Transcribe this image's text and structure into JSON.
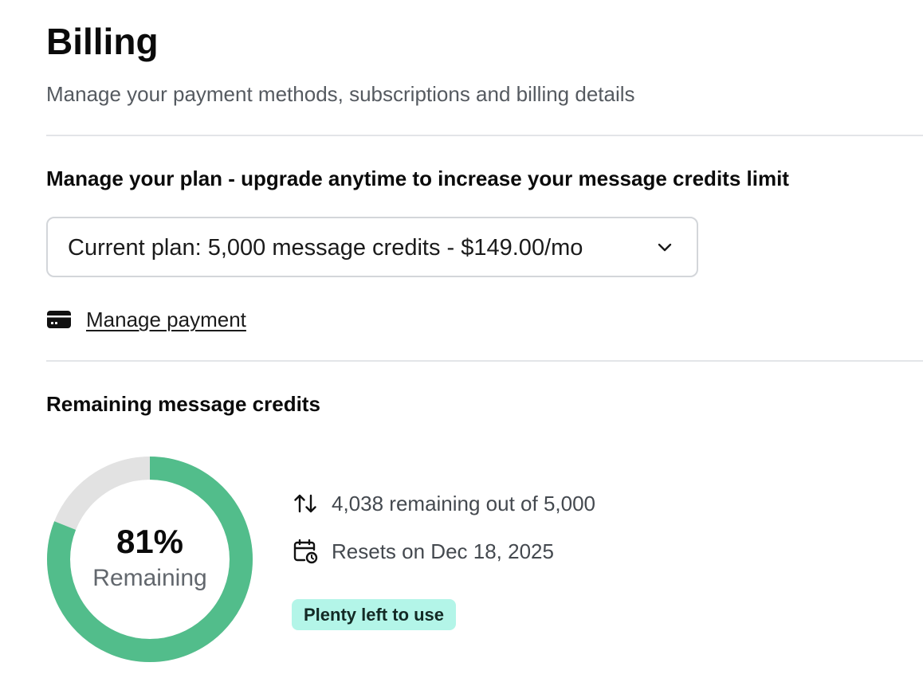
{
  "header": {
    "title": "Billing",
    "subtitle": "Manage your payment methods, subscriptions and billing details"
  },
  "plan": {
    "heading": "Manage your plan - upgrade anytime to increase your message credits limit",
    "select_value": "Current plan: 5,000 message credits - $149.00/mo",
    "select_icon": "chevron-down-icon",
    "manage_payment_label": "Manage payment",
    "manage_payment_icon": "credit-card-icon"
  },
  "credits": {
    "heading": "Remaining message credits",
    "percent_label": "81%",
    "remaining_fraction": 0.81,
    "caption": "Remaining",
    "remaining_text": "4,038 remaining out of 5,000",
    "remaining_icon": "arrows-up-down-icon",
    "reset_text": "Resets on Dec 18, 2025",
    "reset_icon": "calendar-clock-icon",
    "status_badge": "Plenty left to use"
  },
  "colors": {
    "accent_green": "#52bd8b",
    "track_gray": "#e2e2e2",
    "badge_background": "#b3f5e8",
    "text_primary": "#0b0b0b",
    "text_secondary": "#555a60",
    "border": "#d3d6da"
  }
}
